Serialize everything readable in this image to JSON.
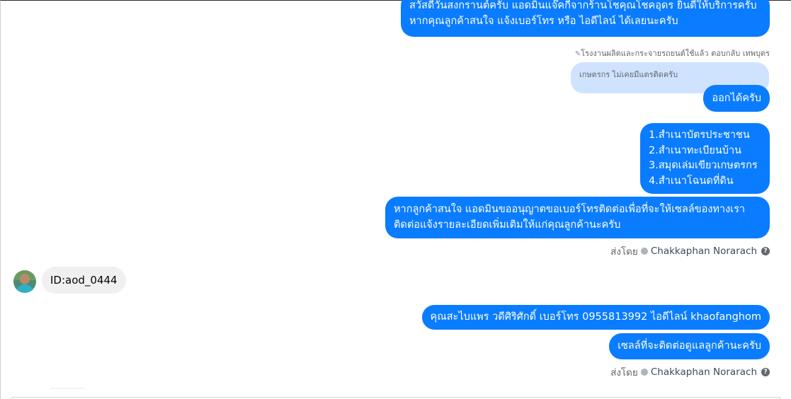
{
  "messages": {
    "greeting": {
      "line1": "สวัสดีวันสงกรานต์ครับ แอดมินแจ๊คกี้จากร้านโชคุณโชคอุดร ยินดีให้บริการครับ",
      "line2": "หากคุณลูกค้าสนใจ แจ้งเบอร์โทร หรือ ไอดีไลน์ ได้เลยนะครับ"
    },
    "reply_label": "โรงงานผลิตและกระจายรถยนต์ใช้แล้ว ตอบกลับ เทพบุตร",
    "quoted_text": "เกษตรกร ไม่เคยมีแตรติดครับ",
    "reply_msg": "ออกได้ครับ",
    "documents": {
      "line1": "1.สำเนาบัตรประชาชน",
      "line2": "2.สำเนาทะเบียนบ้าน",
      "line3": "3.สมุดเล่มเขียวเกษตรกร",
      "line4": "4.สำเนาโฉนดที่ดิน"
    },
    "request_phone": {
      "line1": "หากลูกค้าสนใจ แอดมินขออนุญาตขอเบอร์โทรติดต่อเพื่อที่จะให้เซลล์ของทางเรา",
      "line2": "ติดต่อแจ้งรายละเอียดเพิ่มเติมให้แก่คุณลูกค้านะครับ"
    },
    "sent_by_1": {
      "prefix": "ส่งโดย",
      "name": "Chakkaphan Norarach"
    },
    "incoming_id": "ID:aod_0444",
    "contact_info": "คุณสะไบแพร วดีศิริศักดิ์ เบอร์โทร 0955813992  ไอดีไลน์  khaofanghom",
    "sales_followup": "เซลล์ที่จะติดต่อดูแลลูกค้านะครับ",
    "sent_by_2": {
      "prefix": "ส่งโดย",
      "name": "Chakkaphan Norarach"
    }
  },
  "colors": {
    "outgoing_bubble": "#0a7cff",
    "incoming_bubble": "#f0f0f0",
    "quoted_bubble": "#cfe3ff"
  },
  "icons": [
    "pencil-icon",
    "verified-shield-icon",
    "help-icon",
    "avatar"
  ]
}
